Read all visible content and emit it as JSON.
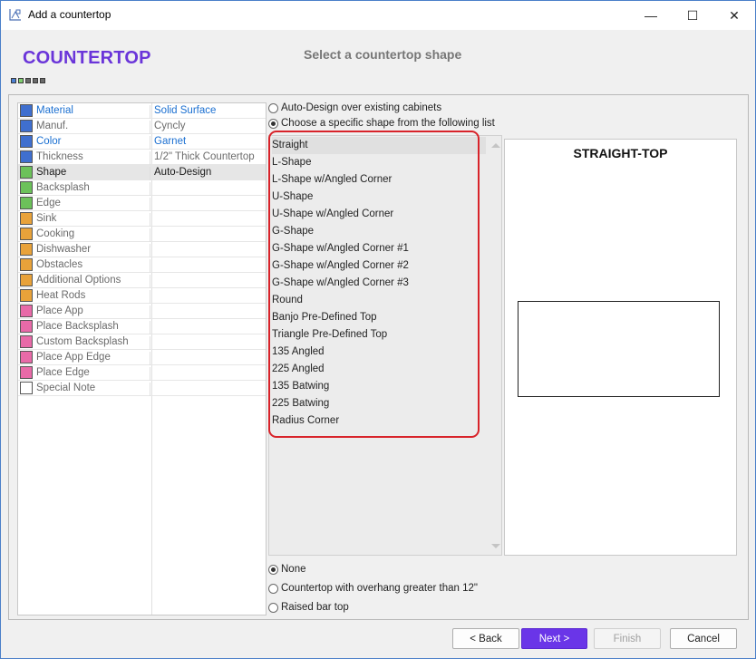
{
  "window": {
    "title": "Add a countertop",
    "controls": {
      "minimize": "—",
      "maximize": "☐",
      "close": "✕"
    }
  },
  "header": {
    "brand": "COUNTERTOP",
    "subtitle": "Select a countertop shape",
    "progress_colors": [
      "#4a7fd4",
      "#7fcf6f",
      "#6a6a6a",
      "#6a6a6a",
      "#6a6a6a"
    ]
  },
  "properties": [
    {
      "name": "Material",
      "value": "Solid Surface",
      "swatch": "#3f6fcf",
      "name_class": "tc-blue",
      "value_class": "tc-blue"
    },
    {
      "name": "Manuf.",
      "value": "Cyncly",
      "swatch": "#3f6fcf",
      "name_class": "tc-gray",
      "value_class": "tc-gray"
    },
    {
      "name": "Color",
      "value": "Garnet",
      "swatch": "#3f6fcf",
      "name_class": "tc-blue",
      "value_class": "tc-blue"
    },
    {
      "name": "Thickness",
      "value": "1/2\" Thick Countertop",
      "swatch": "#3f6fcf",
      "name_class": "tc-gray",
      "value_class": "tc-gray"
    },
    {
      "name": "Shape",
      "value": "Auto-Design",
      "swatch": "#6cc15a",
      "name_class": "tc-dark",
      "value_class": "tc-dark",
      "selected": true
    },
    {
      "name": "Backsplash",
      "value": "",
      "swatch": "#6cc15a",
      "name_class": "tc-gray",
      "value_class": "tc-gray"
    },
    {
      "name": "Edge",
      "value": "",
      "swatch": "#6cc15a",
      "name_class": "tc-gray",
      "value_class": "tc-gray"
    },
    {
      "name": "Sink",
      "value": "",
      "swatch": "#e8a23a",
      "name_class": "tc-gray",
      "value_class": "tc-gray"
    },
    {
      "name": "Cooking",
      "value": "",
      "swatch": "#e8a23a",
      "name_class": "tc-gray",
      "value_class": "tc-gray"
    },
    {
      "name": "Dishwasher",
      "value": "",
      "swatch": "#e8a23a",
      "name_class": "tc-gray",
      "value_class": "tc-gray"
    },
    {
      "name": "Obstacles",
      "value": "",
      "swatch": "#e8a23a",
      "name_class": "tc-gray",
      "value_class": "tc-gray"
    },
    {
      "name": "Additional Options",
      "value": "",
      "swatch": "#e8a23a",
      "name_class": "tc-gray",
      "value_class": "tc-gray"
    },
    {
      "name": "Heat Rods",
      "value": "",
      "swatch": "#e8a23a",
      "name_class": "tc-gray",
      "value_class": "tc-gray"
    },
    {
      "name": "Place App",
      "value": "",
      "swatch": "#e86aa8",
      "name_class": "tc-gray",
      "value_class": "tc-gray"
    },
    {
      "name": "Place Backsplash",
      "value": "",
      "swatch": "#e86aa8",
      "name_class": "tc-gray",
      "value_class": "tc-gray"
    },
    {
      "name": "Custom Backsplash",
      "value": "",
      "swatch": "#e86aa8",
      "name_class": "tc-gray",
      "value_class": "tc-gray"
    },
    {
      "name": "Place App Edge",
      "value": "",
      "swatch": "#e86aa8",
      "name_class": "tc-gray",
      "value_class": "tc-gray"
    },
    {
      "name": "Place Edge",
      "value": "",
      "swatch": "#e86aa8",
      "name_class": "tc-gray",
      "value_class": "tc-gray"
    },
    {
      "name": "Special Note",
      "value": "",
      "swatch": "#ffffff",
      "name_class": "tc-gray",
      "value_class": "tc-gray"
    }
  ],
  "design_mode": {
    "auto_label": "Auto-Design over existing cabinets",
    "specific_label": "Choose a specific shape from the following list",
    "selected": "specific"
  },
  "shapes": {
    "selected": "Straight",
    "items": [
      "Straight",
      "L-Shape",
      "L-Shape w/Angled Corner",
      "U-Shape",
      "U-Shape w/Angled Corner",
      "G-Shape",
      "G-Shape w/Angled Corner #1",
      "G-Shape w/Angled Corner #2",
      "G-Shape w/Angled Corner #3",
      "Round",
      "Banjo Pre-Defined Top",
      "Triangle Pre-Defined Top",
      "135 Angled",
      "225 Angled",
      "135 Batwing",
      "225 Batwing",
      "Radius Corner"
    ]
  },
  "preview": {
    "title": "STRAIGHT-TOP"
  },
  "overhang": {
    "options": [
      "None",
      "Countertop with overhang greater than 12\"",
      "Raised bar top"
    ],
    "selected": "None"
  },
  "buttons": {
    "back": "< Back",
    "next": "Next >",
    "finish": "Finish",
    "cancel": "Cancel"
  }
}
